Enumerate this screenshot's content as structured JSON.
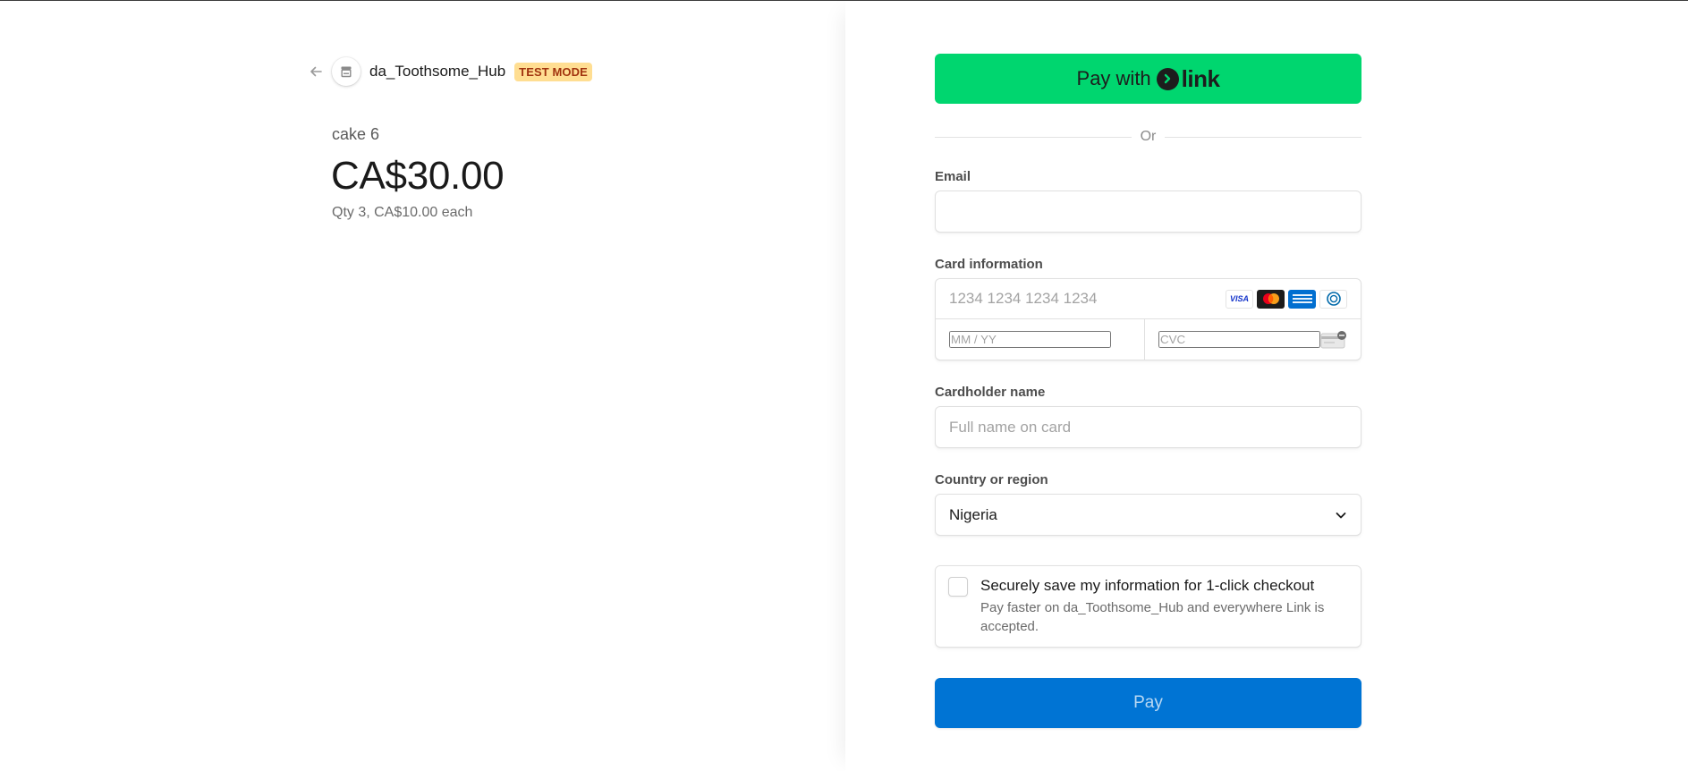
{
  "merchant": {
    "name": "da_Toothsome_Hub",
    "badge": "TEST MODE"
  },
  "product": {
    "name": "cake 6",
    "price": "CA$30.00",
    "qty_line": "Qty 3, CA$10.00 each"
  },
  "link_button": {
    "label": "Pay with",
    "logo_word": "link"
  },
  "divider_text": "Or",
  "email": {
    "label": "Email",
    "placeholder": "",
    "value": ""
  },
  "card": {
    "label": "Card information",
    "number_placeholder": "1234 1234 1234 1234",
    "expiry_placeholder": "MM / YY",
    "cvc_placeholder": "CVC",
    "brands": [
      "visa",
      "mastercard",
      "amex",
      "diners"
    ],
    "visa_text": "VISA"
  },
  "cardholder": {
    "label": "Cardholder name",
    "placeholder": "Full name on card"
  },
  "country": {
    "label": "Country or region",
    "selected": "Nigeria"
  },
  "save_info": {
    "title": "Securely save my information for 1-click checkout",
    "description": "Pay faster on da_Toothsome_Hub and everywhere Link is accepted.",
    "checked": false
  },
  "pay_button": {
    "label": "Pay"
  },
  "colors": {
    "link_green": "#00d66f",
    "pay_blue": "#0074d4",
    "badge_bg": "#ffde92",
    "badge_text": "#a1330e"
  }
}
